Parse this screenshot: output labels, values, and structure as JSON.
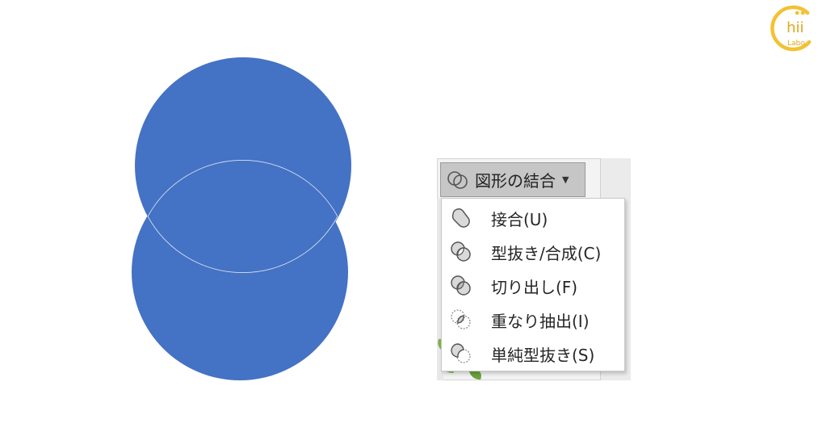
{
  "colors": {
    "shape_fill": "#4472c4",
    "logo_accent": "#f2c233",
    "logo_text": "#e0a71c"
  },
  "logo": {
    "text_main": "hii",
    "text_sub": "Labo",
    "icon": "chii-labo-logo"
  },
  "toolbar": {
    "merge_button": {
      "label": "図形の結合",
      "icon": "merge-shapes-icon",
      "caret_icon": "dropdown-caret-icon"
    }
  },
  "menu": {
    "items": [
      {
        "label": "接合(U)",
        "icon": "union-icon"
      },
      {
        "label": "型抜き/合成(C)",
        "icon": "combine-icon"
      },
      {
        "label": "切り出し(F)",
        "icon": "fragment-icon"
      },
      {
        "label": "重なり抽出(I)",
        "icon": "intersect-icon"
      },
      {
        "label": "単純型抜き(S)",
        "icon": "subtract-icon"
      }
    ]
  }
}
